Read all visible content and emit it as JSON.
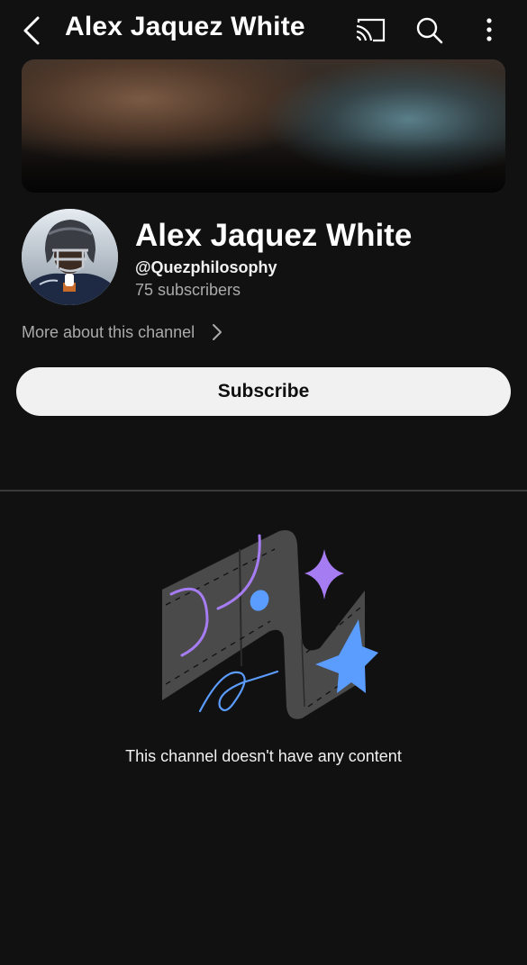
{
  "topbar": {
    "title": "Alex Jaquez White",
    "icons": [
      "back-icon",
      "cast-icon",
      "search-icon",
      "more-vert-icon"
    ]
  },
  "channel": {
    "name": "Alex Jaquez White",
    "handle": "@Quezphilosophy",
    "subscribers": "75 subscribers",
    "more_about": "More about this channel",
    "subscribe_label": "Subscribe"
  },
  "empty_state": {
    "message": "This channel doesn't have any content",
    "colors": {
      "shape": "#4a4a4a",
      "purple": "#a67cf2",
      "blue": "#5b9cff"
    }
  },
  "colors": {
    "background": "#111112",
    "button_bg": "#f1f1f1",
    "secondary_text": "#aaaaaa"
  }
}
